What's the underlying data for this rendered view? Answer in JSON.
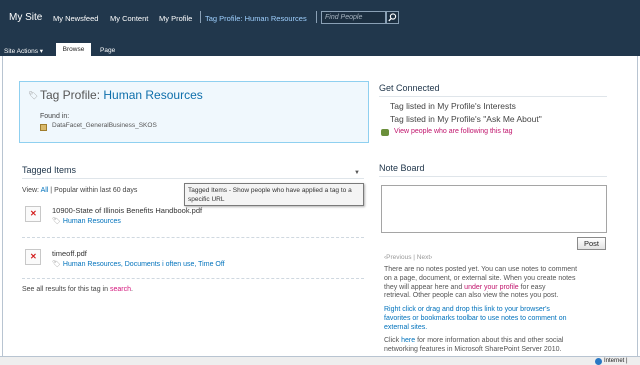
{
  "header": {
    "site_title": "My Site",
    "nav": [
      "My Newsfeed",
      "My Content",
      "My Profile"
    ],
    "tag_profile_link": "Tag Profile: Human Resources",
    "search_placeholder": "Find People"
  },
  "ribbon": {
    "site_actions": "Site Actions",
    "tabs": [
      "Browse",
      "Page"
    ],
    "active_tab": "Browse"
  },
  "tag_profile": {
    "prefix": "Tag Profile: ",
    "name": "Human Resources",
    "found_in_label": "Found in:",
    "found_in_value": "DataFacet_GeneralBusiness_SKOS"
  },
  "tagged_items": {
    "title": "Tagged Items",
    "view_label": "View:",
    "view_all": "All",
    "view_sep": "|",
    "view_popular": "Popular within last 60 days",
    "tooltip": "Tagged Items - Show people who have applied a tag to a specific URL",
    "items": [
      {
        "title": "10900-State of Illinois Benefits Handbook.pdf",
        "tags": "Human Resources"
      },
      {
        "title": "timeoff.pdf",
        "tags": "Human Resources, Documents i often use, Time Off"
      }
    ],
    "see_all_prefix": "See all results for this tag in",
    "see_all_link": "search",
    "see_all_suffix": "."
  },
  "get_connected": {
    "title": "Get Connected",
    "items": [
      "Tag listed in My Profile's Interests",
      "Tag listed in My Profile's \"Ask Me About\""
    ],
    "people_link": "View people who are following this tag"
  },
  "note_board": {
    "title": "Note Board",
    "post_label": "Post",
    "pager_prev": "Previous",
    "pager_sep": "|",
    "pager_next": "Next",
    "empty_line1": "There are no notes posted yet. You can use notes to comment",
    "empty_line2": "on a page, document, or external site. When you create notes",
    "empty_line3a": "they will appear here and",
    "empty_line3_link": "under your profile",
    "empty_line3b": "for easy",
    "empty_line4": "retrieval. Other people can also view the notes you post.",
    "drag_line1": "Right click or drag and drop this link to your browser's",
    "drag_line2": "favorites or bookmarks toolbar to use notes to comment on",
    "drag_line3": "external sites.",
    "click_a": "Click",
    "click_link": "here",
    "click_b": "for more information about this and other social",
    "click_line2": "networking features in Microsoft SharePoint Server 2010."
  },
  "status": {
    "zone": "Internet |"
  },
  "colors": {
    "topbar": "#21374c",
    "link": "#0072bc",
    "accent_link": "#c0146c",
    "profile_box_bg": "#f0f8fd",
    "profile_box_border": "#8fd0f0"
  },
  "icons": [
    "tag-icon",
    "search-icon",
    "pdf-broken-icon",
    "people-icon",
    "internet-zone-icon"
  ]
}
